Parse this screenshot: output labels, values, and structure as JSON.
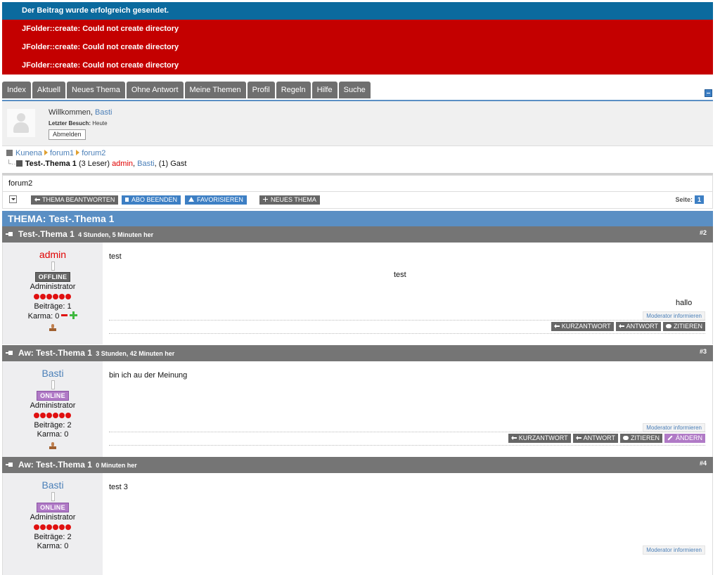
{
  "messages": {
    "success": "Der Beitrag wurde erfolgreich gesendet.",
    "errors": [
      "JFolder::create: Could not create directory",
      "JFolder::create: Could not create directory",
      "JFolder::create: Could not create directory"
    ]
  },
  "tabs": [
    "Index",
    "Aktuell",
    "Neues Thema",
    "Ohne Antwort",
    "Meine Themen",
    "Profil",
    "Regeln",
    "Hilfe",
    "Suche"
  ],
  "profile": {
    "welcome_prefix": "Willkommen,",
    "username": "Basti",
    "last_visit_label": "Letzter Besuch:",
    "last_visit_value": "Heute",
    "logout_label": "Abmelden"
  },
  "breadcrumb": {
    "items": [
      "Kunena",
      "forum1",
      "forum2"
    ],
    "topic": "Test-.Thema 1",
    "readers": "(3 Leser)",
    "reader_admin": "admin",
    "reader_basti": "Basti",
    "guests": "(1) Gast"
  },
  "forum_name": "forum2",
  "actions": {
    "reply": "THEMA BEANTWORTEN",
    "unsubscribe": "ABO BEENDEN",
    "favorite": "FAVORISIEREN",
    "new_topic": "NEUES THEMA",
    "page_label": "Seite:",
    "page": "1"
  },
  "topic_header": "THEMA: Test-.Thema 1",
  "post_labels": {
    "modinfo": "Moderator informieren",
    "quick_reply": "KURZANTWORT",
    "reply": "ANTWORT",
    "quote": "ZITIEREN",
    "edit": "ÄNDERN",
    "posts_prefix": "Beiträge:",
    "karma_prefix": "Karma:"
  },
  "posts": [
    {
      "subject": "Test-.Thema 1",
      "time": "4 Stunden, 5 Minuten her",
      "number": "#2",
      "user": "admin",
      "status": "OFFLINE",
      "role": "Administrator",
      "post_count": "1",
      "karma": "0",
      "text": "test",
      "text_center": "test",
      "text_right": "hallo"
    },
    {
      "subject": "Aw: Test-.Thema 1",
      "time": "3 Stunden, 42 Minuten her",
      "number": "#3",
      "user": "Basti",
      "status": "ONLINE",
      "role": "Administrator",
      "post_count": "2",
      "karma": "0",
      "text": "bin ich au der Meinung"
    },
    {
      "subject": "Aw: Test-.Thema 1",
      "time": "0 Minuten her",
      "number": "#4",
      "user": "Basti",
      "status": "ONLINE",
      "role": "Administrator",
      "post_count": "2",
      "karma": "0",
      "text": "test 3"
    }
  ],
  "colors": {
    "success_bg": "#0b6a9e",
    "error_bg": "#c40000",
    "accent": "#5a8fc4",
    "tab_bg": "#6f6f6f",
    "online": "#b07ac6",
    "admin_name": "#e00000"
  }
}
